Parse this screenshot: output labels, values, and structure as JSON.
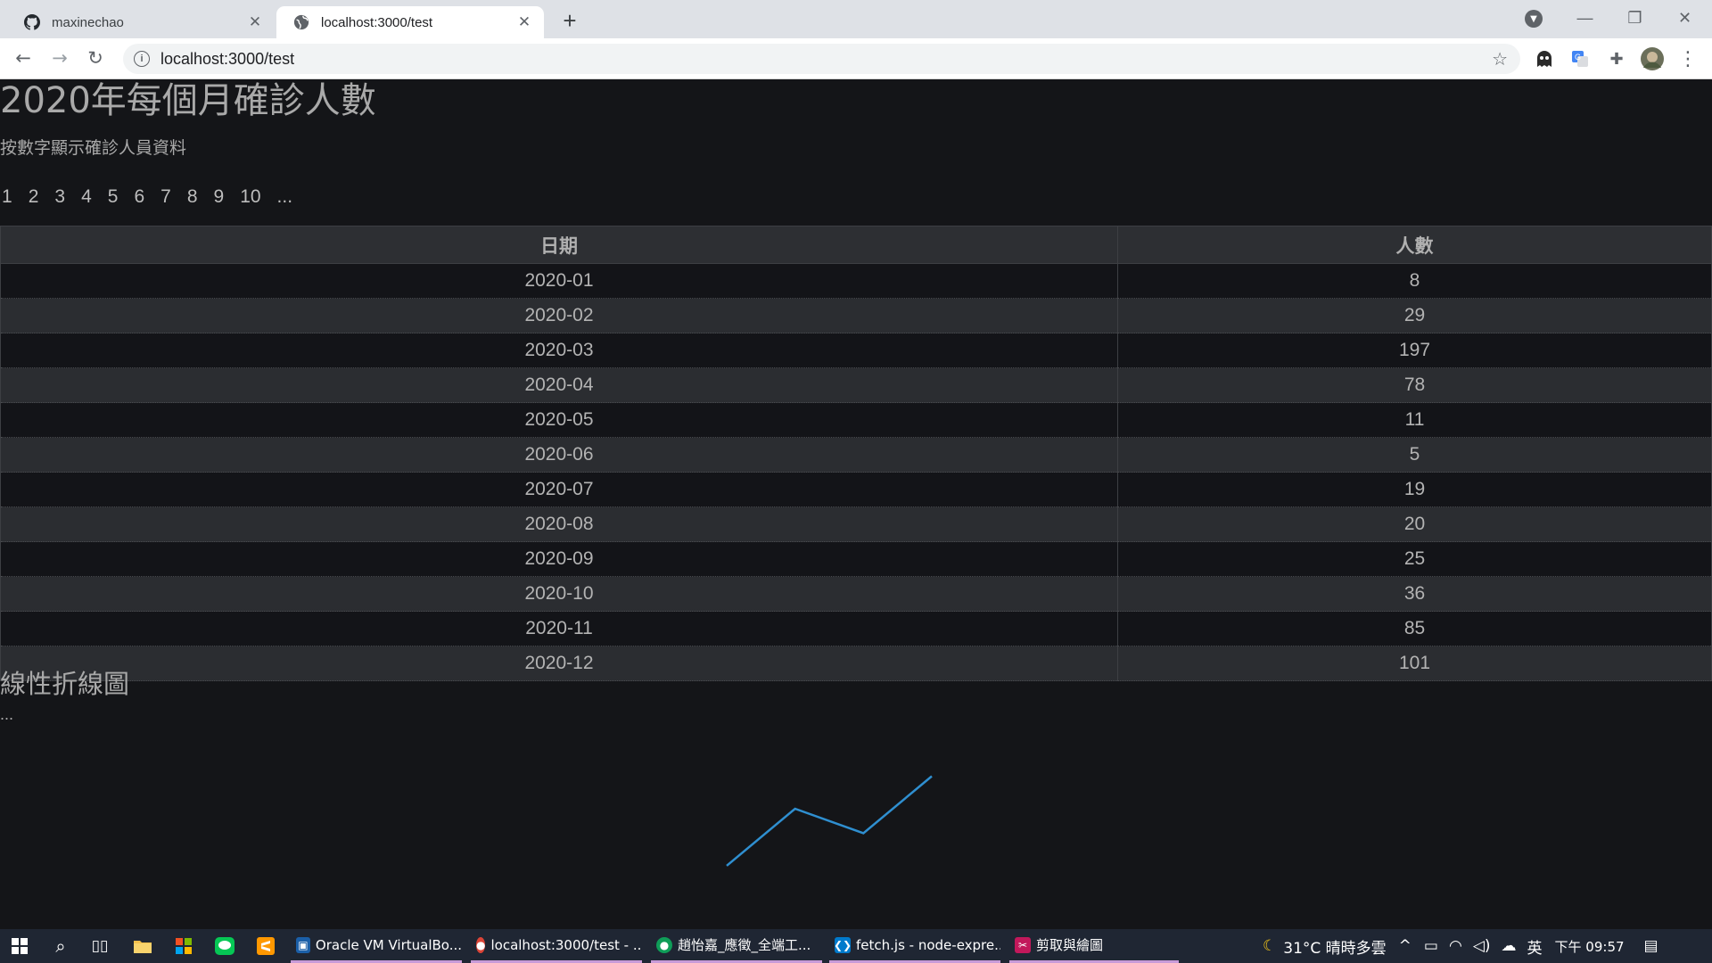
{
  "browser": {
    "tabs": [
      {
        "title": "maxinechao",
        "icon": "github-icon"
      },
      {
        "title": "localhost:3000/test",
        "icon": "globe-icon"
      }
    ],
    "address": "localhost:3000/test"
  },
  "page": {
    "title": "2020年每個月確診人數",
    "subtitle": "按數字顯示確診人員資料",
    "pagination": [
      "1",
      "2",
      "3",
      "4",
      "5",
      "6",
      "7",
      "8",
      "9",
      "10",
      "..."
    ],
    "table": {
      "headers": [
        "日期",
        "人數"
      ],
      "rows": [
        [
          "2020-01",
          "8"
        ],
        [
          "2020-02",
          "29"
        ],
        [
          "2020-03",
          "197"
        ],
        [
          "2020-04",
          "78"
        ],
        [
          "2020-05",
          "11"
        ],
        [
          "2020-06",
          "5"
        ],
        [
          "2020-07",
          "19"
        ],
        [
          "2020-08",
          "20"
        ],
        [
          "2020-09",
          "25"
        ],
        [
          "2020-10",
          "36"
        ],
        [
          "2020-11",
          "85"
        ],
        [
          "2020-12",
          "101"
        ]
      ]
    },
    "chart_title": "線性折線圖",
    "chart_note": "..."
  },
  "chart_data": {
    "type": "line",
    "title": "",
    "x": [
      1,
      2,
      3,
      4
    ],
    "series": [
      {
        "values": [
          5,
          40,
          25,
          60
        ]
      }
    ],
    "color": "#2f8fd0",
    "ylim": [
      0,
      80
    ],
    "grid": false
  },
  "taskbar": {
    "apps": [
      {
        "label": "Oracle VM VirtualBo...",
        "icon": "virtualbox-icon"
      },
      {
        "label": "localhost:3000/test - ...",
        "icon": "chrome-icon"
      },
      {
        "label": "趙怡嘉_應徵_全端工...",
        "icon": "chrome-icon"
      },
      {
        "label": "fetch.js - node-expre...",
        "icon": "vscode-icon"
      },
      {
        "label": "剪取與繪圖",
        "icon": "snip-sketch-icon"
      }
    ],
    "weather": "31°C 晴時多雲",
    "ime": "英",
    "clock": "下午 09:57"
  }
}
